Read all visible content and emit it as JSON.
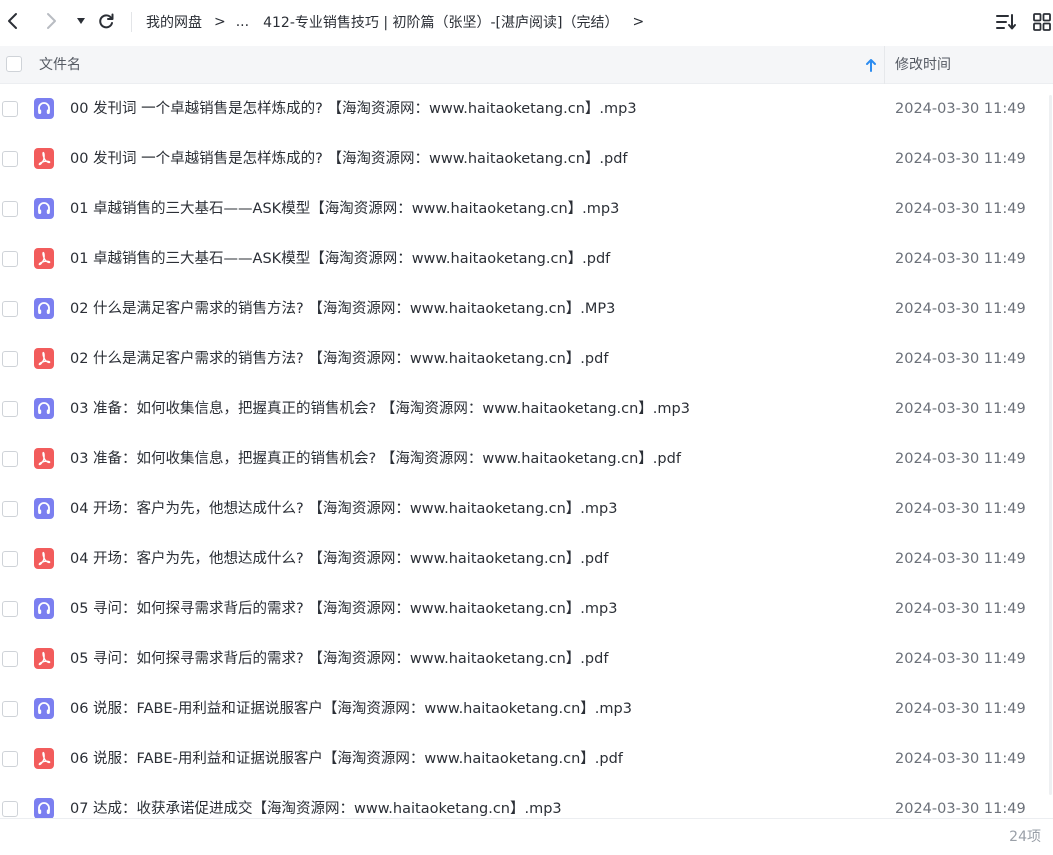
{
  "toolbar": {
    "breadcrumb_root": "我的网盘",
    "breadcrumb_sep": ">",
    "breadcrumb_ellipsis": "...",
    "breadcrumb_current": "412-专业销售技巧 | 初阶篇（张坚）-[湛庐阅读]（完结）",
    "breadcrumb_more": ">"
  },
  "header": {
    "name_label": "文件名",
    "time_label": "修改时间",
    "sort_direction": "ascending"
  },
  "colors": {
    "audio_icon": "#7b7ff0",
    "pdf_icon": "#f25c5c",
    "sort_arrow": "#2d8cf0"
  },
  "files": [
    {
      "type": "audio",
      "icon": "headphones-icon",
      "name": "00 发刊词  一个卓越销售是怎样炼成的? 【海淘资源网：www.haitaoketang.cn】.mp3",
      "modified": "2024-03-30 11:49"
    },
    {
      "type": "pdf",
      "icon": "pdf-icon",
      "name": "00 发刊词  一个卓越销售是怎样炼成的? 【海淘资源网：www.haitaoketang.cn】.pdf",
      "modified": "2024-03-30 11:49"
    },
    {
      "type": "audio",
      "icon": "headphones-icon",
      "name": "01 卓越销售的三大基石——ASK模型【海淘资源网：www.haitaoketang.cn】.mp3",
      "modified": "2024-03-30 11:49"
    },
    {
      "type": "pdf",
      "icon": "pdf-icon",
      "name": "01 卓越销售的三大基石——ASK模型【海淘资源网：www.haitaoketang.cn】.pdf",
      "modified": "2024-03-30 11:49"
    },
    {
      "type": "audio",
      "icon": "headphones-icon",
      "name": "02 什么是满足客户需求的销售方法? 【海淘资源网：www.haitaoketang.cn】.MP3",
      "modified": "2024-03-30 11:49"
    },
    {
      "type": "pdf",
      "icon": "pdf-icon",
      "name": "02 什么是满足客户需求的销售方法? 【海淘资源网：www.haitaoketang.cn】.pdf",
      "modified": "2024-03-30 11:49"
    },
    {
      "type": "audio",
      "icon": "headphones-icon",
      "name": "03 准备：如何收集信息，把握真正的销售机会? 【海淘资源网：www.haitaoketang.cn】.mp3",
      "modified": "2024-03-30 11:49"
    },
    {
      "type": "pdf",
      "icon": "pdf-icon",
      "name": "03 准备：如何收集信息，把握真正的销售机会? 【海淘资源网：www.haitaoketang.cn】.pdf",
      "modified": "2024-03-30 11:49"
    },
    {
      "type": "audio",
      "icon": "headphones-icon",
      "name": "04 开场：客户为先，他想达成什么? 【海淘资源网：www.haitaoketang.cn】.mp3",
      "modified": "2024-03-30 11:49"
    },
    {
      "type": "pdf",
      "icon": "pdf-icon",
      "name": "04 开场：客户为先，他想达成什么? 【海淘资源网：www.haitaoketang.cn】.pdf",
      "modified": "2024-03-30 11:49"
    },
    {
      "type": "audio",
      "icon": "headphones-icon",
      "name": "05 寻问：如何探寻需求背后的需求? 【海淘资源网：www.haitaoketang.cn】.mp3",
      "modified": "2024-03-30 11:49"
    },
    {
      "type": "pdf",
      "icon": "pdf-icon",
      "name": "05 寻问：如何探寻需求背后的需求? 【海淘资源网：www.haitaoketang.cn】.pdf",
      "modified": "2024-03-30 11:49"
    },
    {
      "type": "audio",
      "icon": "headphones-icon",
      "name": "06 说服：FABE-用利益和证据说服客户【海淘资源网：www.haitaoketang.cn】.mp3",
      "modified": "2024-03-30 11:49"
    },
    {
      "type": "pdf",
      "icon": "pdf-icon",
      "name": "06 说服：FABE-用利益和证据说服客户【海淘资源网：www.haitaoketang.cn】.pdf",
      "modified": "2024-03-30 11:49"
    },
    {
      "type": "audio",
      "icon": "headphones-icon",
      "name": "07 达成：收获承诺促进成交【海淘资源网：www.haitaoketang.cn】.mp3",
      "modified": "2024-03-30 11:49"
    }
  ],
  "footer": {
    "item_count": "24项"
  }
}
